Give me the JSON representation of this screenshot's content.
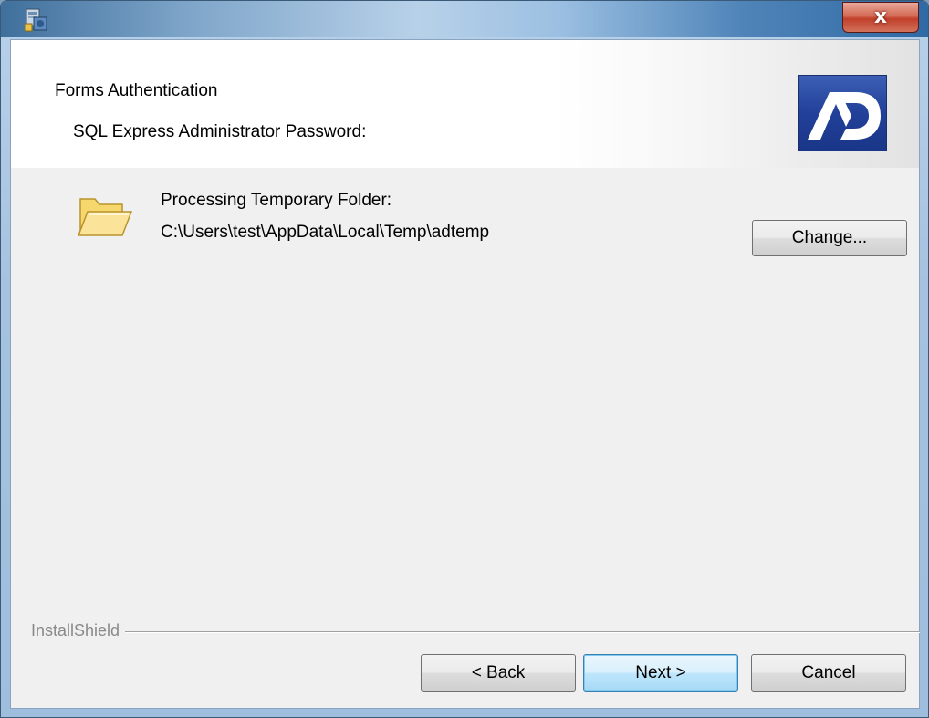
{
  "titlebar": {
    "title": "",
    "close_label": "x"
  },
  "banner": {
    "title": "Forms Authentication",
    "subtitle": "SQL Express Administrator Password:",
    "logo_text": "AD"
  },
  "content": {
    "folder_label": "Processing Temporary Folder:",
    "folder_path": "C:\\Users\\test\\AppData\\Local\\Temp\\adtemp",
    "change_button": "Change..."
  },
  "footer": {
    "brand": "InstallShield",
    "back_button": "< Back",
    "next_button": "Next >",
    "cancel_button": "Cancel"
  },
  "icons": {
    "app": "installer-icon",
    "close": "close-icon",
    "folder": "folder-icon",
    "logo": "ad-logo"
  },
  "colors": {
    "titlebar_blue": "#9fbddd",
    "close_red": "#c1402a",
    "dialog_bg": "#f0f0f0",
    "logo_blue": "#22409a",
    "default_button": "#bee6fd"
  }
}
